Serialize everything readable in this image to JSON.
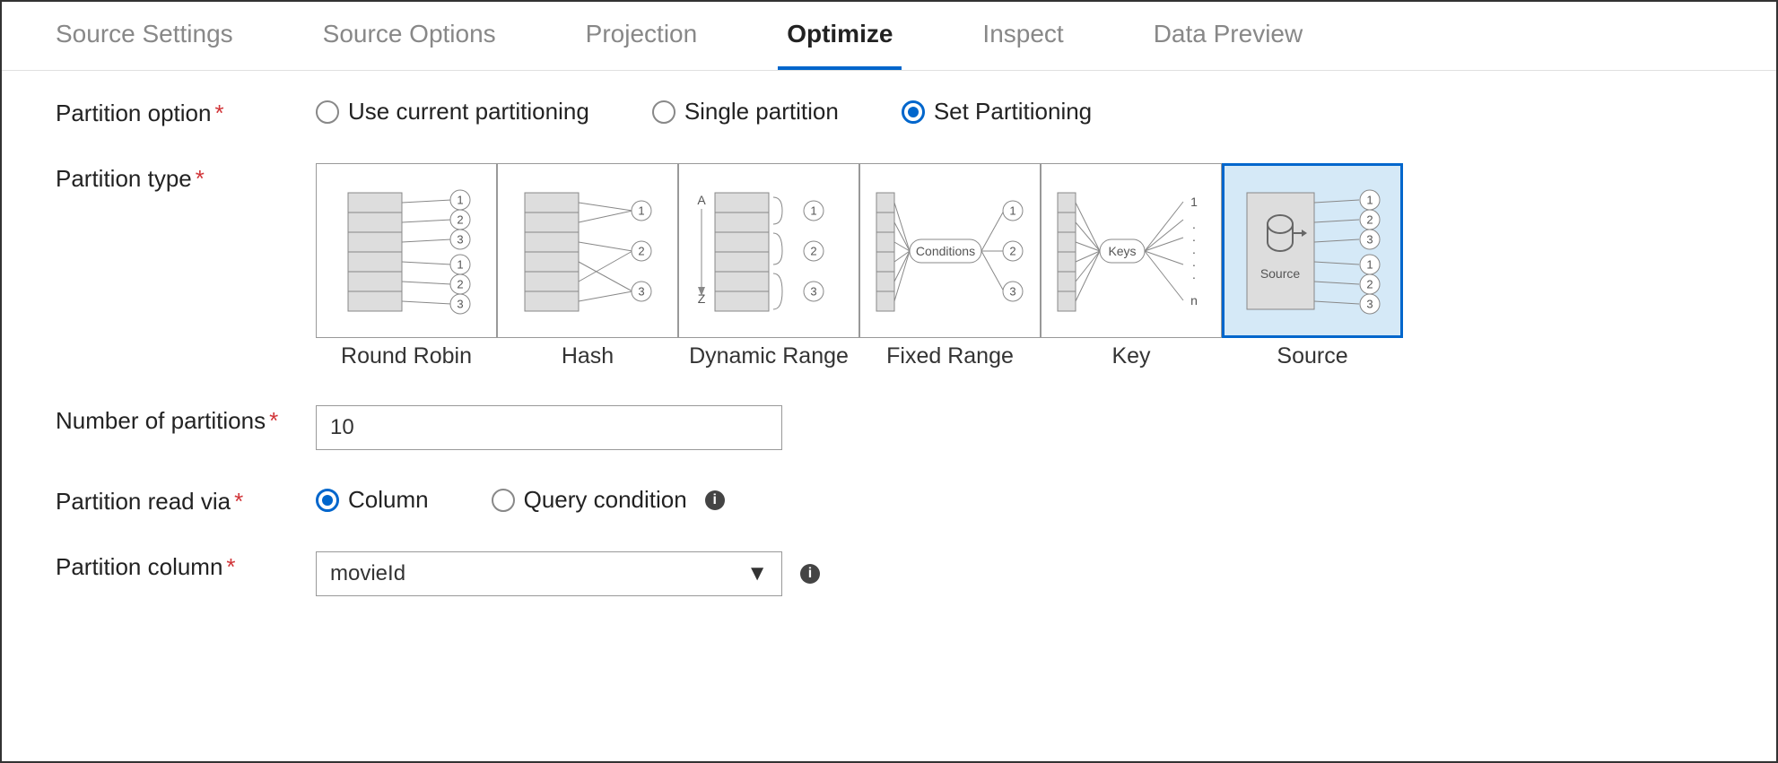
{
  "tabs": [
    {
      "label": "Source Settings",
      "active": false
    },
    {
      "label": "Source Options",
      "active": false
    },
    {
      "label": "Projection",
      "active": false
    },
    {
      "label": "Optimize",
      "active": true
    },
    {
      "label": "Inspect",
      "active": false
    },
    {
      "label": "Data Preview",
      "active": false
    }
  ],
  "partition_option": {
    "label": "Partition option",
    "required": true,
    "options": [
      {
        "label": "Use current partitioning",
        "selected": false
      },
      {
        "label": "Single partition",
        "selected": false
      },
      {
        "label": "Set Partitioning",
        "selected": true
      }
    ]
  },
  "partition_type": {
    "label": "Partition type",
    "required": true,
    "options": [
      {
        "label": "Round Robin",
        "selected": false
      },
      {
        "label": "Hash",
        "selected": false
      },
      {
        "label": "Dynamic Range",
        "selected": false
      },
      {
        "label": "Fixed Range",
        "selected": false
      },
      {
        "label": "Key",
        "selected": false
      },
      {
        "label": "Source",
        "selected": true
      }
    ]
  },
  "num_partitions": {
    "label": "Number of partitions",
    "required": true,
    "value": "10"
  },
  "partition_read_via": {
    "label": "Partition read via",
    "required": true,
    "options": [
      {
        "label": "Column",
        "selected": true
      },
      {
        "label": "Query condition",
        "selected": false
      }
    ]
  },
  "partition_column": {
    "label": "Partition column",
    "required": true,
    "value": "movieId"
  },
  "diagrams": {
    "source_label": "Source",
    "conditions_label": "Conditions",
    "keys_label": "Keys",
    "range_a": "A",
    "range_z": "Z"
  }
}
